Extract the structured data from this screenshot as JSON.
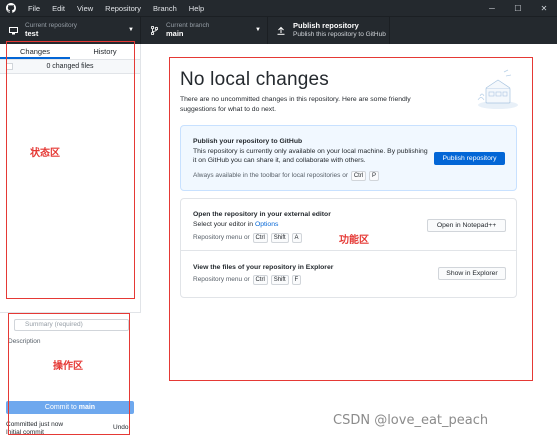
{
  "menu": [
    "File",
    "Edit",
    "View",
    "Repository",
    "Branch",
    "Help"
  ],
  "window_controls": {
    "minimize": "─",
    "maximize": "☐",
    "close": "✕"
  },
  "toolbar": {
    "repo_label": "Current repository",
    "repo_value": "test",
    "branch_label": "Current branch",
    "branch_value": "main",
    "publish_title": "Publish repository",
    "publish_sub": "Publish this repository to GitHub"
  },
  "sidebar": {
    "tab_changes": "Changes",
    "tab_history": "History",
    "changed_files": "0 changed files",
    "summary_placeholder": "Summary (required)",
    "description_label": "Description",
    "commit_prefix": "Commit to ",
    "commit_branch": "main",
    "last_commit_line1": "Committed just now",
    "last_commit_line2": "Initial commit",
    "undo": "Undo"
  },
  "main": {
    "title": "No local changes",
    "intro": "There are no uncommitted changes in this repository. Here are some friendly suggestions for what to do next.",
    "publish_card": {
      "heading": "Publish your repository to GitHub",
      "body": "This repository is currently only available on your local machine. By publishing it on GitHub you can share it, and collaborate with others.",
      "hint": "Always available in the toolbar for local repositories or",
      "hint_keys": [
        "Ctrl",
        "P"
      ],
      "button": "Publish repository"
    },
    "editor_row": {
      "heading": "Open the repository in your external editor",
      "select_prefix": "Select your editor in ",
      "options_link": "Options",
      "menu_hint": "Repository menu or",
      "keys": [
        "Ctrl",
        "Shift",
        "A"
      ],
      "button": "Open in Notepad++"
    },
    "explorer_row": {
      "heading": "View the files of your repository in Explorer",
      "menu_hint": "Repository menu or",
      "keys": [
        "Ctrl",
        "Shift",
        "F"
      ],
      "button": "Show in Explorer"
    }
  },
  "annotations": {
    "status_area": "状态区",
    "function_area": "功能区",
    "operation_area": "操作区",
    "color": "#e53935"
  },
  "watermark": "CSDN @love_eat_peach",
  "colors": {
    "titlebar": "#24292e",
    "accent": "#0366d6",
    "commit_button": "#6ea8ee",
    "card_blue": "#f1f8ff"
  }
}
